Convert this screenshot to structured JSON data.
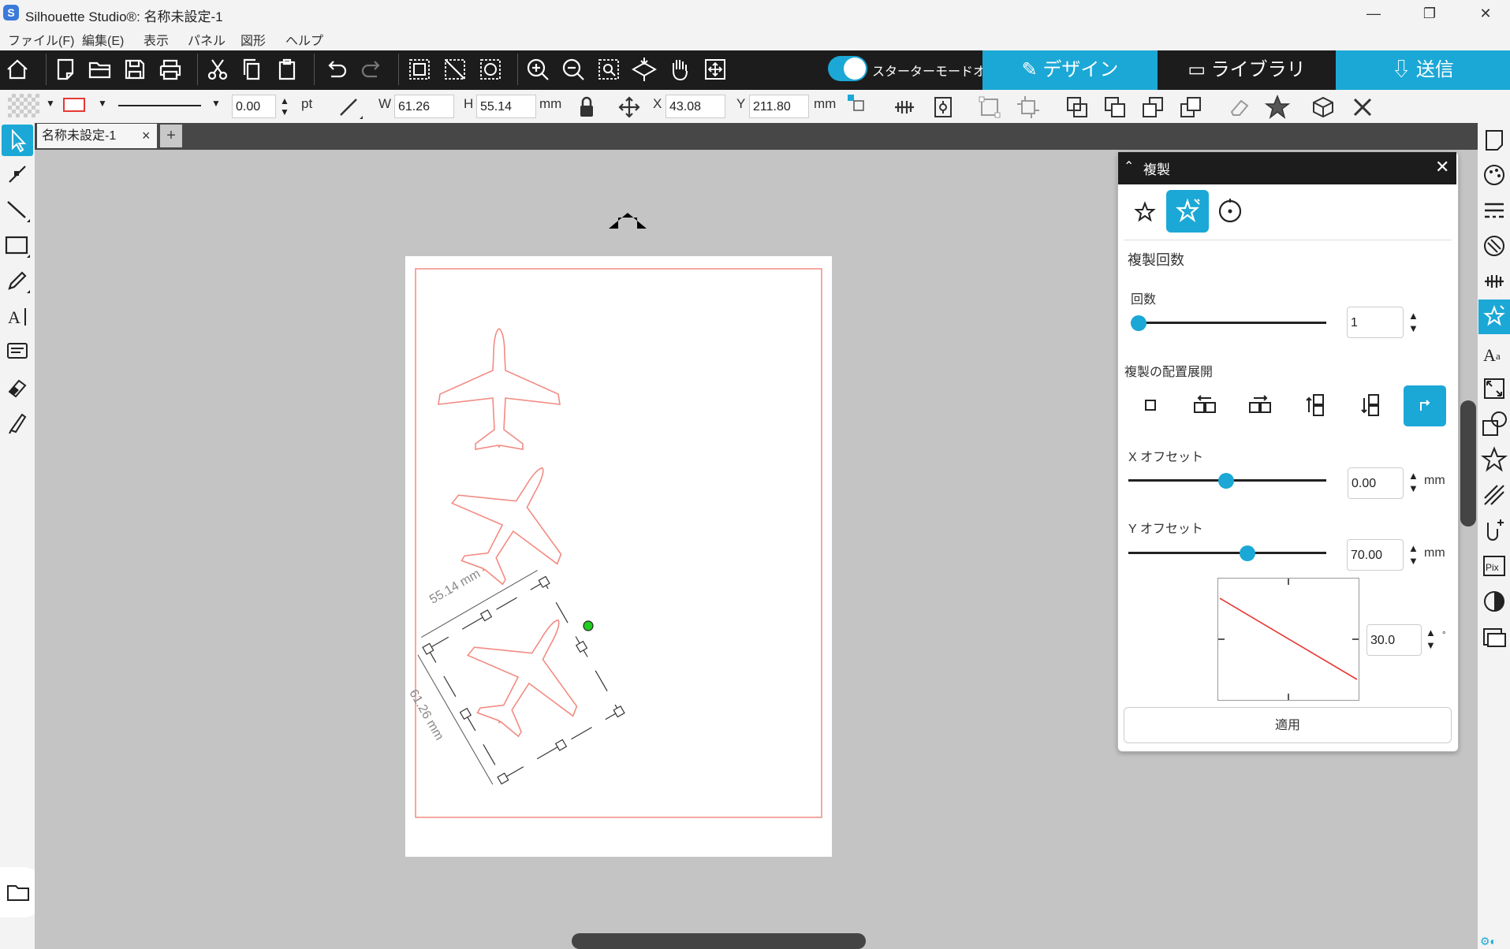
{
  "window": {
    "title": "Silhouette Studio®: 名称未設定-1",
    "app_icon": "S",
    "minimize": "—",
    "restore": "❐",
    "close": "✕"
  },
  "menu": [
    "ファイル(F)",
    "編集(E)",
    "表示",
    "パネル",
    "図形",
    "ヘルプ"
  ],
  "toolbar": {
    "starter_mode_label": "スターターモードオフ",
    "tabs": {
      "design": "デザイン",
      "library": "ライブラリ",
      "send": "送信"
    },
    "accent_color": "#1ba8d6"
  },
  "props": {
    "line_width": "0.00",
    "line_unit": "pt",
    "w_label": "W",
    "w_value": "61.26",
    "h_label": "H",
    "h_value": "55.14",
    "size_unit": "mm",
    "x_label": "X",
    "x_value": "43.08",
    "y_label": "Y",
    "y_value": "211.80",
    "pos_unit": "mm"
  },
  "document": {
    "tab_name": "名称未設定-1",
    "tab_close": "×",
    "tab_add": "+"
  },
  "canvas": {
    "dim_width_label": "55.14 mm",
    "dim_height_label": "61.26 mm",
    "shape_color": "#f28b82"
  },
  "duplicate_panel": {
    "title": "複製",
    "close": "✕",
    "section_count": "複製回数",
    "count_label": "回数",
    "count_value": "1",
    "layout_label": "複製の配置展開",
    "x_offset_label": "X オフセット",
    "x_offset_value": "0.00",
    "y_offset_label": "Y オフセット",
    "y_offset_value": "70.00",
    "unit": "mm",
    "angle_value": "30.0",
    "angle_unit": "°",
    "apply_label": "適用",
    "count_slider": 0.0,
    "x_slider": 0.5,
    "y_slider": 0.6
  }
}
